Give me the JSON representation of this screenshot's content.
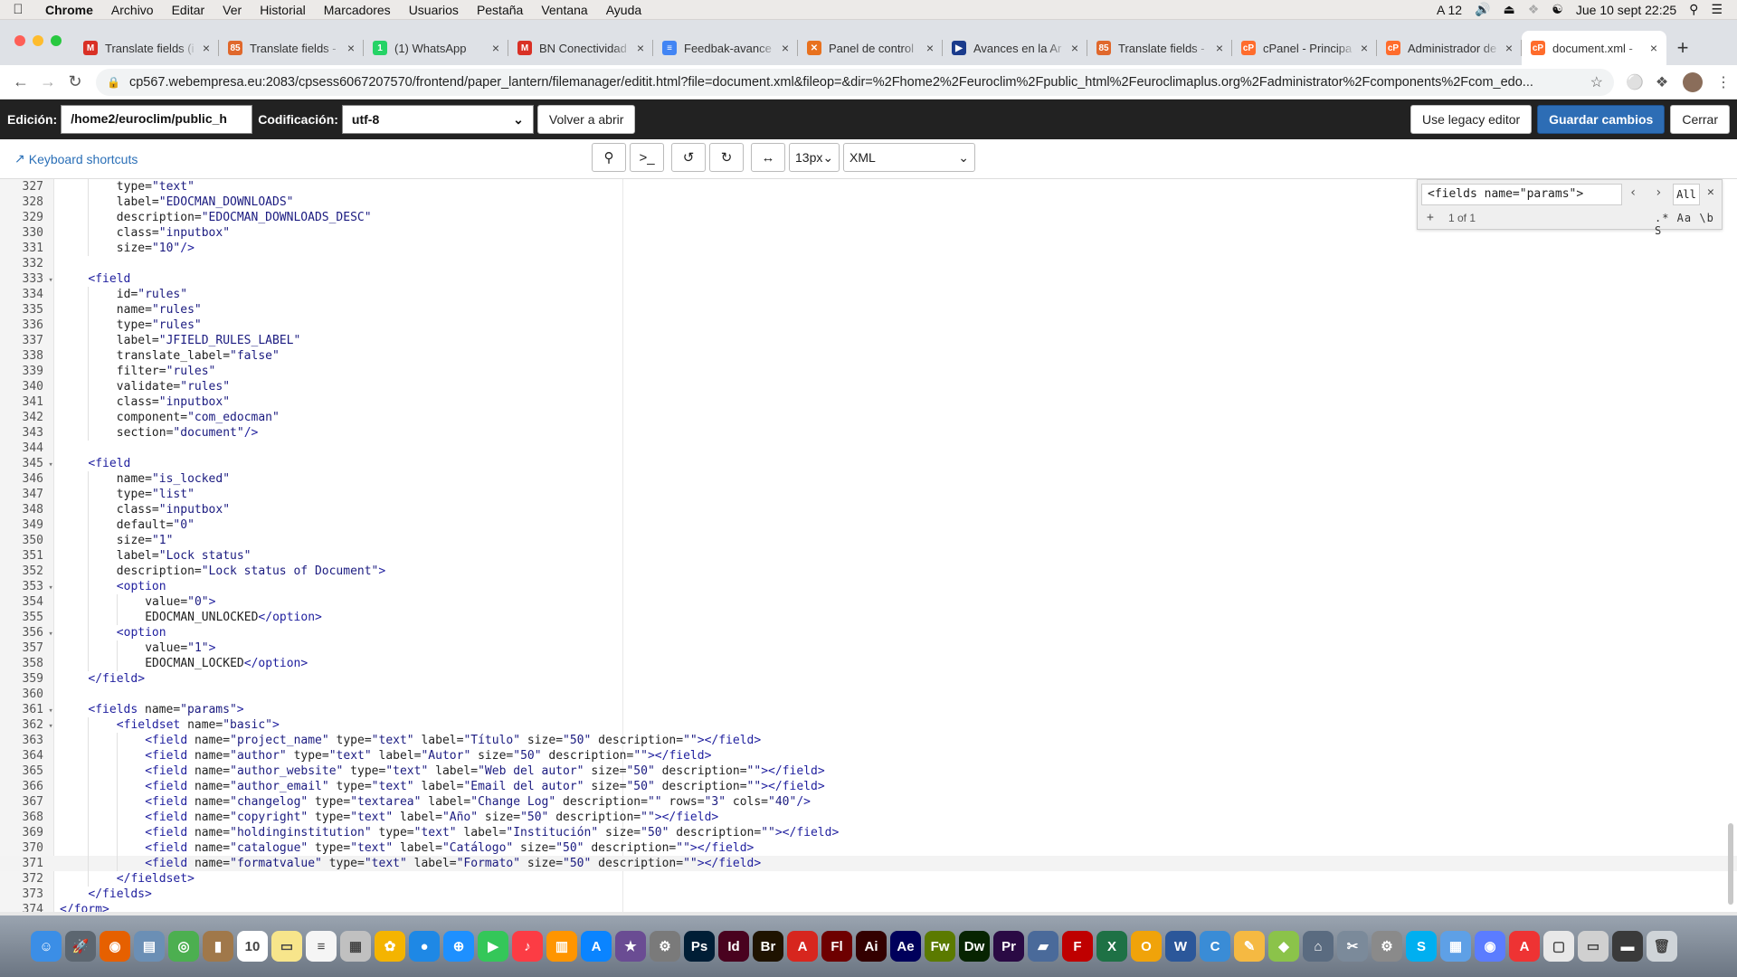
{
  "menubar": {
    "app": "Chrome",
    "items": [
      "Archivo",
      "Editar",
      "Ver",
      "Historial",
      "Marcadores",
      "Usuarios",
      "Pestaña",
      "Ventana",
      "Ayuda"
    ],
    "status": {
      "input": "A 12",
      "datetime": "Jue 10 sept  22:25"
    }
  },
  "tabs": [
    {
      "label": "Translate fields (i",
      "icon": "gmail-icon",
      "color": "#d93025",
      "glyph": "M"
    },
    {
      "label": "Translate fields -",
      "icon": "joomla-icon",
      "color": "#e0682c",
      "glyph": "85"
    },
    {
      "label": "(1) WhatsApp",
      "icon": "whatsapp-icon",
      "color": "#25d366",
      "glyph": "1"
    },
    {
      "label": "BN Conectividad",
      "icon": "gmail-icon",
      "color": "#d93025",
      "glyph": "M"
    },
    {
      "label": "Feedbak-avance",
      "icon": "docs-icon",
      "color": "#4285f4",
      "glyph": "≡"
    },
    {
      "label": "Panel de control",
      "icon": "joomla-icon",
      "color": "#e8711e",
      "glyph": "✕"
    },
    {
      "label": "Avances en la Ar",
      "icon": "planner-icon",
      "color": "#1a3b8c",
      "glyph": "▶"
    },
    {
      "label": "Translate fields -",
      "icon": "joomla-icon",
      "color": "#e0682c",
      "glyph": "85"
    },
    {
      "label": "cPanel - Principa",
      "icon": "cpanel-icon",
      "color": "#ff6c2c",
      "glyph": "cP"
    },
    {
      "label": "Administrador de",
      "icon": "cpanel-icon",
      "color": "#ff6c2c",
      "glyph": "cP"
    },
    {
      "label": "document.xml -",
      "icon": "cpanel-icon",
      "color": "#ff6c2c",
      "glyph": "cP",
      "active": true
    }
  ],
  "address": {
    "url": "cp567.webempresa.eu:2083/cpsess6067207570/frontend/paper_lantern/filemanager/editit.html?file=document.xml&fileop=&dir=%2Fhome2%2Feuroclim%2Fpublic_html%2Feuroclimaplus.org%2Fadministrator%2Fcomponents%2Fcom_edo..."
  },
  "editor_bar": {
    "edit_label": "Edición:",
    "path": "/home2/euroclim/public_h",
    "encoding_label": "Codificación:",
    "encoding": "utf-8",
    "reopen": "Volver a abrir",
    "legacy": "Use legacy editor",
    "save": "Guardar cambios",
    "close": "Cerrar"
  },
  "toolbar": {
    "shortcuts": "Keyboard shortcuts",
    "font_size": "13px",
    "mode": "XML"
  },
  "search": {
    "query": "<fields name=\"params\">",
    "count": "1 of 1",
    "all": "All",
    "opts": ".* Aa \\b S"
  },
  "code_lines": [
    {
      "n": 327,
      "indent": 2,
      "text": "type=\"text\""
    },
    {
      "n": 328,
      "indent": 2,
      "text": "label=\"EDOCMAN_DOWNLOADS\""
    },
    {
      "n": 329,
      "indent": 2,
      "text": "description=\"EDOCMAN_DOWNLOADS_DESC\""
    },
    {
      "n": 330,
      "indent": 2,
      "text": "class=\"inputbox\""
    },
    {
      "n": 331,
      "indent": 2,
      "text": "size=\"10\"/>"
    },
    {
      "n": 332,
      "indent": 0,
      "text": ""
    },
    {
      "n": 333,
      "indent": 1,
      "text": "<field",
      "fold": true
    },
    {
      "n": 334,
      "indent": 2,
      "text": "id=\"rules\""
    },
    {
      "n": 335,
      "indent": 2,
      "text": "name=\"rules\""
    },
    {
      "n": 336,
      "indent": 2,
      "text": "type=\"rules\""
    },
    {
      "n": 337,
      "indent": 2,
      "text": "label=\"JFIELD_RULES_LABEL\""
    },
    {
      "n": 338,
      "indent": 2,
      "text": "translate_label=\"false\""
    },
    {
      "n": 339,
      "indent": 2,
      "text": "filter=\"rules\""
    },
    {
      "n": 340,
      "indent": 2,
      "text": "validate=\"rules\""
    },
    {
      "n": 341,
      "indent": 2,
      "text": "class=\"inputbox\""
    },
    {
      "n": 342,
      "indent": 2,
      "text": "component=\"com_edocman\""
    },
    {
      "n": 343,
      "indent": 2,
      "text": "section=\"document\"/>"
    },
    {
      "n": 344,
      "indent": 0,
      "text": ""
    },
    {
      "n": 345,
      "indent": 1,
      "text": "<field",
      "fold": true
    },
    {
      "n": 346,
      "indent": 2,
      "text": "name=\"is_locked\""
    },
    {
      "n": 347,
      "indent": 2,
      "text": "type=\"list\""
    },
    {
      "n": 348,
      "indent": 2,
      "text": "class=\"inputbox\""
    },
    {
      "n": 349,
      "indent": 2,
      "text": "default=\"0\""
    },
    {
      "n": 350,
      "indent": 2,
      "text": "size=\"1\""
    },
    {
      "n": 351,
      "indent": 2,
      "text": "label=\"Lock status\""
    },
    {
      "n": 352,
      "indent": 2,
      "text": "description=\"Lock status of Document\">"
    },
    {
      "n": 353,
      "indent": 2,
      "text": "<option",
      "fold": true
    },
    {
      "n": 354,
      "indent": 3,
      "text": "value=\"0\">"
    },
    {
      "n": 355,
      "indent": 3,
      "text": "EDOCMAN_UNLOCKED</option>"
    },
    {
      "n": 356,
      "indent": 2,
      "text": "<option",
      "fold": true
    },
    {
      "n": 357,
      "indent": 3,
      "text": "value=\"1\">"
    },
    {
      "n": 358,
      "indent": 3,
      "text": "EDOCMAN_LOCKED</option>"
    },
    {
      "n": 359,
      "indent": 1,
      "text": "</field>"
    },
    {
      "n": 360,
      "indent": 0,
      "text": ""
    },
    {
      "n": 361,
      "indent": 1,
      "text": "<fields name=\"params\">",
      "fold": true
    },
    {
      "n": 362,
      "indent": 2,
      "text": "<fieldset name=\"basic\">",
      "fold": true
    },
    {
      "n": 363,
      "indent": 3,
      "text": "<field name=\"project_name\" type=\"text\" label=\"Título\" size=\"50\" description=\"\"></field>"
    },
    {
      "n": 364,
      "indent": 3,
      "text": "<field name=\"author\" type=\"text\" label=\"Autor\" size=\"50\" description=\"\"></field>"
    },
    {
      "n": 365,
      "indent": 3,
      "text": "<field name=\"author_website\" type=\"text\" label=\"Web del autor\" size=\"50\" description=\"\"></field>"
    },
    {
      "n": 366,
      "indent": 3,
      "text": "<field name=\"author_email\" type=\"text\" label=\"Email del autor\" size=\"50\" description=\"\"></field>"
    },
    {
      "n": 367,
      "indent": 3,
      "text": "<field name=\"changelog\" type=\"textarea\" label=\"Change Log\" description=\"\" rows=\"3\" cols=\"40\"/>"
    },
    {
      "n": 368,
      "indent": 3,
      "text": "<field name=\"copyright\" type=\"text\" label=\"Año\" size=\"50\" description=\"\"></field>"
    },
    {
      "n": 369,
      "indent": 3,
      "text": "<field name=\"holdinginstitution\" type=\"text\" label=\"Institución\" size=\"50\" description=\"\"></field>"
    },
    {
      "n": 370,
      "indent": 3,
      "text": "<field name=\"catalogue\" type=\"text\" label=\"Catálogo\" size=\"50\" description=\"\"></field>"
    },
    {
      "n": 371,
      "indent": 3,
      "text": "<field name=\"formatvalue\" type=\"text\" label=\"Formato\" size=\"50\" description=\"\"></field>",
      "active": true
    },
    {
      "n": 372,
      "indent": 2,
      "text": "</fieldset>"
    },
    {
      "n": 373,
      "indent": 1,
      "text": "</fields>"
    },
    {
      "n": 374,
      "indent": 0,
      "text": "</form>"
    }
  ],
  "dock": [
    {
      "name": "finder-icon",
      "color": "#3b8ee6",
      "glyph": "☺"
    },
    {
      "name": "launchpad-icon",
      "color": "#5c6670",
      "glyph": "🚀"
    },
    {
      "name": "firefox-icon",
      "color": "#e66000",
      "glyph": "◉"
    },
    {
      "name": "preview-icon",
      "color": "#6b8fb5",
      "glyph": "▤"
    },
    {
      "name": "chrome-icon",
      "color": "#4caf50",
      "glyph": "◎"
    },
    {
      "name": "contacts-icon",
      "color": "#a0784a",
      "glyph": "▮"
    },
    {
      "name": "calendar-icon",
      "color": "#ffffff",
      "glyph": "10"
    },
    {
      "name": "notes-icon",
      "color": "#f7e58b",
      "glyph": "▭"
    },
    {
      "name": "reminders-icon",
      "color": "#f5f5f5",
      "glyph": "≡"
    },
    {
      "name": "photo-booth-icon",
      "color": "#c0c0c0",
      "glyph": "▦"
    },
    {
      "name": "photos-icon",
      "color": "#f4b400",
      "glyph": "✿"
    },
    {
      "name": "messages-icon",
      "color": "#1e88e5",
      "glyph": "●"
    },
    {
      "name": "safari-icon",
      "color": "#1e90ff",
      "glyph": "⊕"
    },
    {
      "name": "facetime-icon",
      "color": "#34c759",
      "glyph": "▶"
    },
    {
      "name": "music-icon",
      "color": "#fc3c44",
      "glyph": "♪"
    },
    {
      "name": "books-icon",
      "color": "#ff9500",
      "glyph": "▥"
    },
    {
      "name": "app-store-icon",
      "color": "#0a84ff",
      "glyph": "A"
    },
    {
      "name": "imovie-icon",
      "color": "#6a4c93",
      "glyph": "★"
    },
    {
      "name": "automator-icon",
      "color": "#7a7a7a",
      "glyph": "⚙"
    },
    {
      "name": "photoshop-icon",
      "color": "#001e36",
      "glyph": "Ps"
    },
    {
      "name": "indesign-icon",
      "color": "#49021f",
      "glyph": "Id"
    },
    {
      "name": "bridge-icon",
      "color": "#1f1300",
      "glyph": "Br"
    },
    {
      "name": "acrobat-icon",
      "color": "#d7261e",
      "glyph": "A"
    },
    {
      "name": "flash-icon",
      "color": "#6e0000",
      "glyph": "Fl"
    },
    {
      "name": "illustrator-icon",
      "color": "#330000",
      "glyph": "Ai"
    },
    {
      "name": "after-effects-icon",
      "color": "#00005b",
      "glyph": "Ae"
    },
    {
      "name": "fireworks-icon",
      "color": "#5b7a00",
      "glyph": "Fw"
    },
    {
      "name": "dreamweaver-icon",
      "color": "#072401",
      "glyph": "Dw"
    },
    {
      "name": "premiere-icon",
      "color": "#2a0a44",
      "glyph": "Pr"
    },
    {
      "name": "folder-icon",
      "color": "#4a6a9a",
      "glyph": "▰"
    },
    {
      "name": "filezilla-icon",
      "color": "#bf0000",
      "glyph": "F"
    },
    {
      "name": "excel-icon",
      "color": "#1e7145",
      "glyph": "X"
    },
    {
      "name": "outlook-icon",
      "color": "#f0a30a",
      "glyph": "O"
    },
    {
      "name": "word-icon",
      "color": "#2b579a",
      "glyph": "W"
    },
    {
      "name": "cyberduck-icon",
      "color": "#3a8cd6",
      "glyph": "C"
    },
    {
      "name": "textedit-icon",
      "color": "#f5b942",
      "glyph": "✎"
    },
    {
      "name": "sketchup-icon",
      "color": "#8bc34a",
      "glyph": "◆"
    },
    {
      "name": "network-icon",
      "color": "#5a6b80",
      "glyph": "⌂"
    },
    {
      "name": "script-icon",
      "color": "#7b8a9a",
      "glyph": "✂"
    },
    {
      "name": "system-prefs-icon",
      "color": "#8a8a8a",
      "glyph": "⚙"
    },
    {
      "name": "skype-icon",
      "color": "#00aff0",
      "glyph": "S"
    },
    {
      "name": "teams-icon",
      "color": "#5ea0e6",
      "glyph": "▦"
    },
    {
      "name": "siri-icon",
      "color": "#5b7cff",
      "glyph": "◉"
    },
    {
      "name": "pdf-icon",
      "color": "#e33",
      "glyph": "A"
    },
    {
      "name": "documents-icon",
      "color": "#e8e8e8",
      "glyph": "▢"
    },
    {
      "name": "downloads-icon",
      "color": "#d0d0d0",
      "glyph": "▭"
    },
    {
      "name": "screen-icon",
      "color": "#3a3a3a",
      "glyph": "▬"
    },
    {
      "name": "trash-icon",
      "color": "#cfd4d8",
      "glyph": "🗑"
    }
  ]
}
